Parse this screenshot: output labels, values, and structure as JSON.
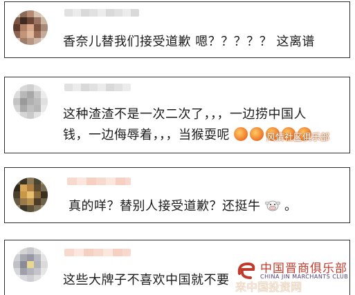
{
  "comments": [
    {
      "text": "香奈儿替我们接受道歉 嗯？？？？？ 这离谱"
    },
    {
      "line1": "这种渣渣不是一次二次了，，，一边捞中国人",
      "line2": "钱，一边侮辱着，，，当猴耍呢"
    },
    {
      "text_before": "真的咩？替别人接受道歉？还挺牛",
      "text_after": "。",
      "emoji": "cow-face-icon"
    },
    {
      "text": "这些大牌子不喜欢中国就不要"
    }
  ],
  "overlay_watermark": "风情社区俱乐部",
  "watermark": {
    "cn": "中国晋商俱乐部",
    "en": "CHINA JIN MARCHANTS CLUB",
    "overlay": "来中国投资网"
  }
}
